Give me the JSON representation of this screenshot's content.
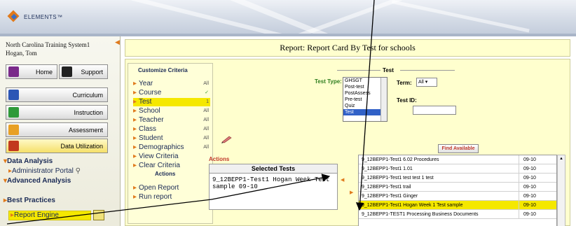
{
  "app": {
    "logo_text": "ELEMENTS™"
  },
  "sidebar": {
    "org_name": "North Carolina Training System1",
    "user": "Hogan, Tom",
    "buttons": {
      "home": "Home",
      "support": "Support",
      "curriculum": "Curriculum",
      "instruction": "Instruction",
      "assessment": "Assessment",
      "data_utilization": "Data Utilization"
    },
    "sections": [
      {
        "label": "Data Analysis",
        "items": [
          "Administrator Portal"
        ]
      },
      {
        "label": "Advanced Analysis",
        "items": [
          "Report Engine"
        ]
      },
      {
        "label": "Best Practices",
        "items": []
      }
    ]
  },
  "report": {
    "title": "Report: Report Card By Test for schools"
  },
  "criteria": {
    "header": "Customize Criteria",
    "items": [
      {
        "label": "Year",
        "value": "All"
      },
      {
        "label": "Course",
        "value": "✓"
      },
      {
        "label": "Test",
        "value": "1"
      },
      {
        "label": "School",
        "value": "All"
      },
      {
        "label": "Teacher",
        "value": "All"
      },
      {
        "label": "Class",
        "value": "All"
      },
      {
        "label": "Student",
        "value": "All"
      },
      {
        "label": "Demographics",
        "value": "All"
      },
      {
        "label": "View Criteria",
        "value": ""
      },
      {
        "label": "Clear Criteria",
        "value": ""
      }
    ],
    "actions_header": "Actions",
    "actions": [
      "Open Report",
      "Run report"
    ]
  },
  "test_filter": {
    "legend": "Test",
    "test_type_label": "Test Type:",
    "test_type_options": [
      "GHSGT",
      "Post-test",
      "PostAssess",
      "Pre-test",
      "Quiz",
      "Test"
    ],
    "selected_test_type": "Test",
    "term_label": "Term:",
    "term_value": "All",
    "test_id_label": "Test ID:",
    "test_id_value": "",
    "find_button": "Find Available"
  },
  "selected_tests": {
    "actions_label": "Actions",
    "header": "Selected Tests",
    "items": [
      "9_12BEPP1-Test1 Hogan Week Test sample 09-10"
    ]
  },
  "available_tests": [
    {
      "name": "9_12BEPP1-Test1 6.02 Procedures",
      "term": "09-10"
    },
    {
      "name": "9_12BEPP1-Test1 1.01",
      "term": "09-10"
    },
    {
      "name": "9_12BEPP1-Test1 test test 1 test",
      "term": "09-10"
    },
    {
      "name": "9_12BEPP1-Test1 trail",
      "term": "09-10"
    },
    {
      "name": "9_12BEPP1-Test1 Ginger",
      "term": "09-10"
    },
    {
      "name": "9_12BEPP1-Test1 Hogan Week 1 Test sample",
      "term": "09-10",
      "highlighted": true
    },
    {
      "name": "9_12BEPP1-TEST1 Processing Business Documents",
      "term": "09-10"
    }
  ],
  "colors": {
    "highlight": "#f5e800",
    "accent": "#e07a1c",
    "panel": "#ffffce"
  }
}
